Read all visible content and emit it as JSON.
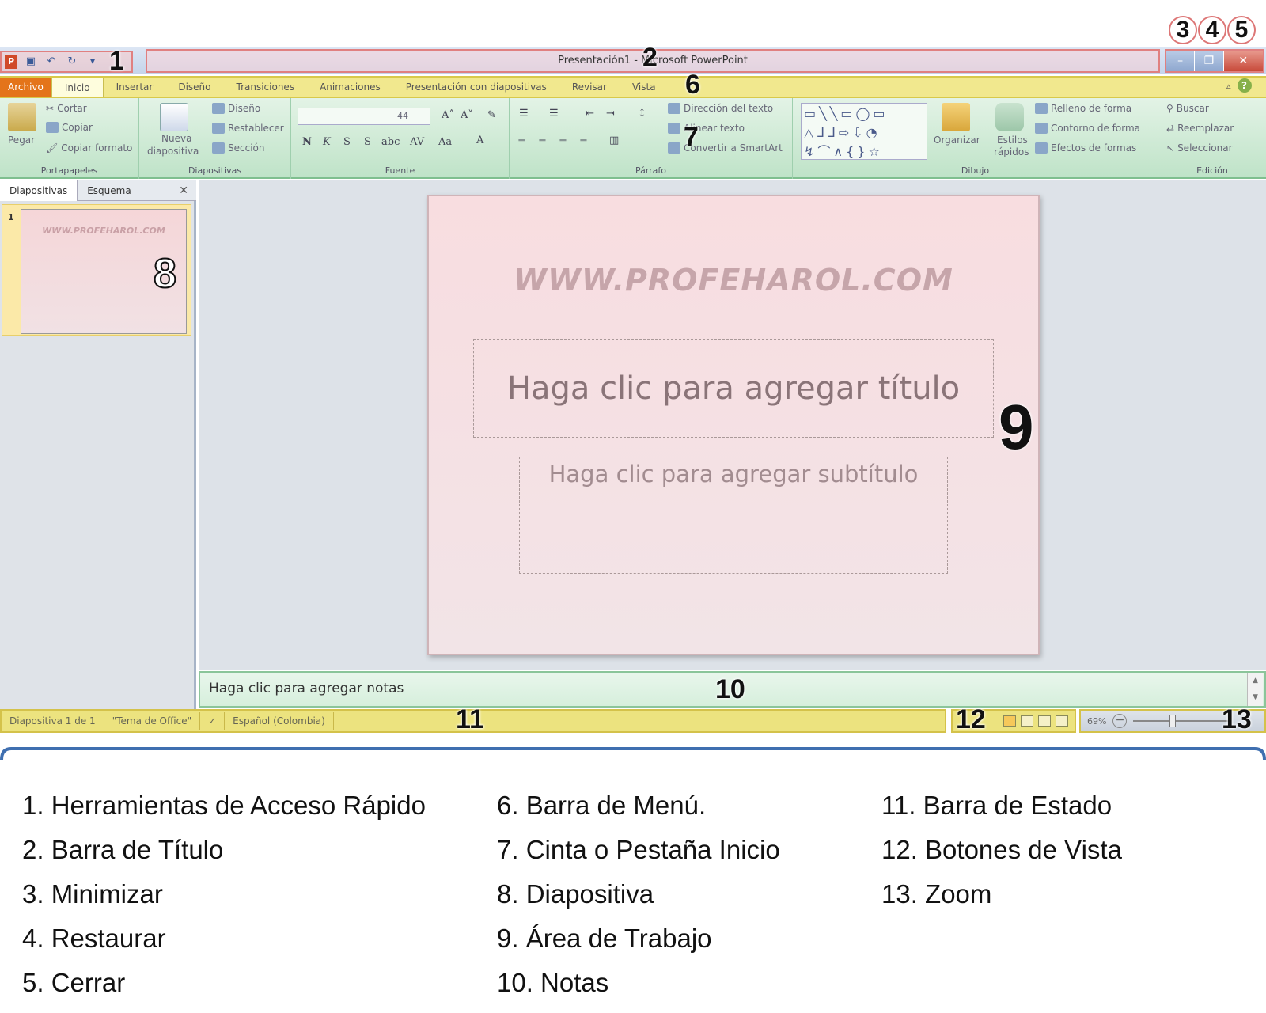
{
  "app": {
    "logo_letter": "P",
    "title": "Presentación1 - Microsoft PowerPoint",
    "qat": [
      "save-icon",
      "undo-icon",
      "redo-icon",
      "customize-icon"
    ]
  },
  "window_controls": {
    "minimize": "–",
    "restore": "❐",
    "close": "✕"
  },
  "menu": {
    "tabs": [
      "Archivo",
      "Inicio",
      "Insertar",
      "Diseño",
      "Transiciones",
      "Animaciones",
      "Presentación con diapositivas",
      "Revisar",
      "Vista"
    ],
    "help": "?"
  },
  "ribbon": {
    "portapapeles": {
      "paste": "Pegar",
      "cut": "Cortar",
      "copy": "Copiar",
      "format_painter": "Copiar formato",
      "label": "Portapapeles"
    },
    "diapositivas": {
      "new_slide_1": "Nueva",
      "new_slide_2": "diapositiva",
      "layout": "Diseño",
      "reset": "Restablecer",
      "section": "Sección",
      "label": "Diapositivas"
    },
    "fuente": {
      "size": "44",
      "bold": "N",
      "italic": "K",
      "underline": "S",
      "shadow": "S",
      "strike": "abc",
      "spacing": "AV",
      "case": "Aa",
      "color": "A",
      "label": "Fuente"
    },
    "parrafo": {
      "text_direction": "Dirección del texto",
      "align_text": "Alinear texto",
      "smartart": "Convertir a SmartArt",
      "label": "Párrafo"
    },
    "dibujo": {
      "arrange": "Organizar",
      "quick_styles_1": "Estilos",
      "quick_styles_2": "rápidos",
      "shape_fill": "Relleno de forma",
      "shape_outline": "Contorno de forma",
      "shape_effects": "Efectos de formas",
      "label": "Dibujo"
    },
    "edicion": {
      "find": "Buscar",
      "replace": "Reemplazar",
      "select": "Seleccionar",
      "label": "Edición"
    }
  },
  "slides_pane": {
    "tab_slides": "Diapositivas",
    "tab_outline": "Esquema",
    "close": "✕",
    "thumb_number": "1",
    "thumb_watermark": "WWW.PROFEHAROL.COM"
  },
  "slide": {
    "watermark": "WWW.PROFEHAROL.COM",
    "title_placeholder": "Haga clic para agregar título",
    "subtitle_placeholder": "Haga clic para agregar subtítulo"
  },
  "notes": {
    "placeholder": "Haga clic para agregar notas"
  },
  "status": {
    "slide_count": "Diapositiva 1 de 1",
    "theme": "\"Tema de Office\"",
    "language": "Español (Colombia)",
    "zoom": "69%"
  },
  "callouts": [
    "1",
    "2",
    "3",
    "4",
    "5",
    "6",
    "7",
    "8",
    "9",
    "10",
    "11",
    "12",
    "13"
  ],
  "legend": {
    "col1": [
      "1. Herramientas de Acceso Rápido",
      "2. Barra de Título",
      "3. Minimizar",
      "4. Restaurar",
      "5. Cerrar"
    ],
    "col2": [
      "6. Barra de Menú.",
      "7. Cinta o Pestaña Inicio",
      "8. Diapositiva",
      "9. Área de Trabajo",
      "10. Notas"
    ],
    "col3": [
      "11. Barra de Estado",
      "12. Botones de Vista",
      "13. Zoom"
    ]
  },
  "colors": {
    "file_tab": "#e4741a",
    "highlight_red": "#e08080",
    "highlight_yellow": "#d8c94a",
    "highlight_green": "#7fbf8f",
    "bracket": "#3f6fb0"
  }
}
